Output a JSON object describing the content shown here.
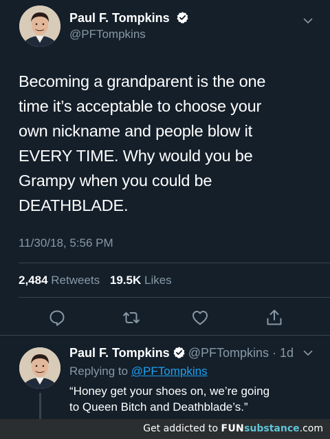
{
  "tweet": {
    "author_name": "Paul F. Tompkins",
    "author_handle": "@PFTompkins",
    "verified": true,
    "text_lines": [
      "Becoming a grandparent is the one",
      "time it’s acceptable to choose your",
      "own nickname and people blow it",
      "EVERY TIME. Why would you be",
      "Grampy when you could be",
      "DEATHBLADE."
    ],
    "timestamp": "11/30/18, 5:56 PM",
    "retweets_count": "2,484",
    "retweets_label": "Retweets",
    "likes_count": "19.5K",
    "likes_label": "Likes",
    "actions": [
      "reply-icon",
      "retweet-icon",
      "like-icon",
      "share-icon"
    ]
  },
  "reply": {
    "author_name": "Paul F. Tompkins",
    "meta": "@PFTompkins · 1d",
    "replying_prefix": "Replying to",
    "replying_handle": "@PFTompkins",
    "text_lines": [
      "“Honey get your shoes on, we’re going",
      "to Queen Bitch and Deathblade’s.”"
    ]
  },
  "watermark": {
    "prefix": "Get addicted to",
    "brand_fun": "FUN",
    "brand_substance": "substance",
    "brand_tld": ".com"
  },
  "colors": {
    "background": "#141f2a",
    "secondary_text": "#8899a6",
    "link": "#1da1f2",
    "verified_badge": "#ffffff"
  }
}
